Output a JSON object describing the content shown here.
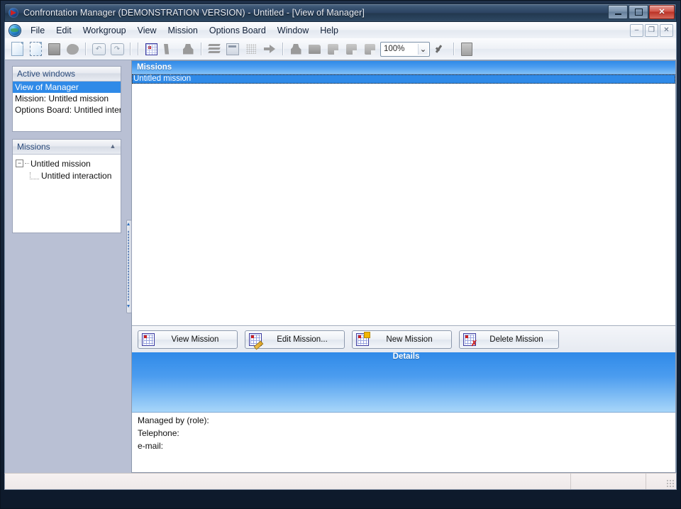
{
  "window": {
    "title": "Confrontation Manager (DEMONSTRATION VERSION) - Untitled - [View of Manager]",
    "app_icon": "globe-arrow-icon",
    "minimize": "–",
    "maximize": "□",
    "close": "✕"
  },
  "menubar": {
    "items": [
      {
        "label": "File"
      },
      {
        "label": "Edit"
      },
      {
        "label": "Workgroup"
      },
      {
        "label": "View"
      },
      {
        "label": "Mission"
      },
      {
        "label": "Options Board"
      },
      {
        "label": "Window"
      },
      {
        "label": "Help"
      }
    ],
    "child_minimize": "–",
    "child_restore": "❐",
    "child_close": "✕"
  },
  "toolbar": {
    "zoom_value": "100%",
    "zoom_caret": "⌄",
    "buttons": [
      {
        "icon": "new-document-icon"
      },
      {
        "icon": "new-from-template-icon"
      },
      {
        "icon": "save-icon"
      },
      {
        "icon": "paste-icon"
      },
      {
        "icon": "undo-icon"
      },
      {
        "icon": "redo-icon"
      },
      {
        "icon": "options-board-icon"
      },
      {
        "icon": "compare-icon"
      },
      {
        "icon": "analysis-icon"
      },
      {
        "icon": "layers-icon"
      },
      {
        "icon": "table-icon"
      },
      {
        "icon": "dotted-grid-icon"
      },
      {
        "icon": "arrow-right-icon"
      },
      {
        "icon": "stakeholders-icon"
      },
      {
        "icon": "folder-icon"
      },
      {
        "icon": "note-1-icon"
      },
      {
        "icon": "note-2-icon"
      },
      {
        "icon": "note-3-icon"
      },
      {
        "icon": "checkmark-icon"
      },
      {
        "icon": "report-icon"
      }
    ]
  },
  "sidebar": {
    "active_windows": {
      "title": "Active windows",
      "items": [
        {
          "label": "View of Manager",
          "selected": true
        },
        {
          "label": "Mission: Untitled mission",
          "selected": false
        },
        {
          "label": "Options Board: Untitled intera",
          "selected": false
        }
      ]
    },
    "missions_panel": {
      "title": "Missions",
      "collapse_icon": "chevron-up-double-icon",
      "root": "Untitled mission",
      "root_expander": "−",
      "child": "Untitled interaction"
    }
  },
  "main": {
    "missions_header": "Missions",
    "missions_rows": [
      {
        "label": "Untitled mission",
        "selected": true
      }
    ],
    "buttons": [
      {
        "label": "View Mission",
        "icon": "grid-view-icon"
      },
      {
        "label": "Edit Mission...",
        "icon": "grid-edit-icon"
      },
      {
        "label": "New Mission",
        "icon": "grid-new-icon"
      },
      {
        "label": "Delete Mission",
        "icon": "grid-delete-icon"
      }
    ],
    "details": {
      "header": "Details",
      "fields": [
        {
          "label": "Managed by (role):"
        },
        {
          "label": "Telephone:"
        },
        {
          "label": "e-mail:"
        }
      ]
    }
  },
  "statusbar": {
    "message": "",
    "cell_1": "",
    "cell_2": ""
  }
}
